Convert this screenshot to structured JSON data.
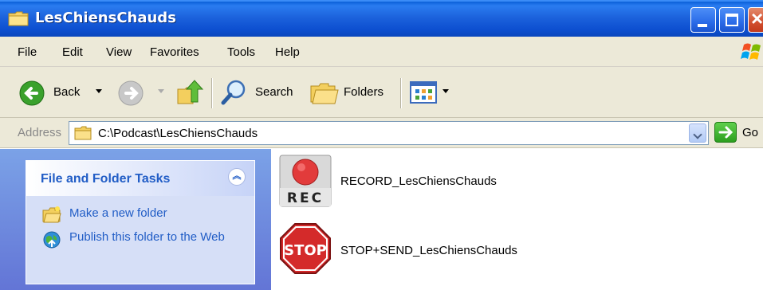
{
  "window": {
    "title": "LesChiensChauds",
    "icon": "folder-icon",
    "controls": [
      "minimize-icon",
      "maximize-icon",
      "close-icon"
    ]
  },
  "menu": [
    "File",
    "Edit",
    "View",
    "Favorites",
    "Tools",
    "Help"
  ],
  "toolbar": {
    "back_label": "Back",
    "search_label": "Search",
    "folders_label": "Folders"
  },
  "address": {
    "label": "Address",
    "path": "C:\\Podcast\\LesChiensChauds",
    "go_label": "Go"
  },
  "tasks": {
    "title": "File and Folder Tasks",
    "items": [
      {
        "label": "Make a new folder",
        "icon": "new-folder-icon"
      },
      {
        "label": "Publish this folder to the Web",
        "icon": "publish-web-icon"
      }
    ]
  },
  "files": [
    {
      "name": "RECORD_LesChiensChauds",
      "icon": "rec-icon",
      "icon_text": "REC"
    },
    {
      "name": "STOP+SEND_LesChiensChauds",
      "icon": "stop-sign-icon",
      "icon_text": "STOP"
    }
  ],
  "colors": {
    "title_bar": "#1c62dc",
    "task_link": "#215dc6",
    "chrome": "#ece9d8",
    "task_pane": "#7ba2e7"
  }
}
